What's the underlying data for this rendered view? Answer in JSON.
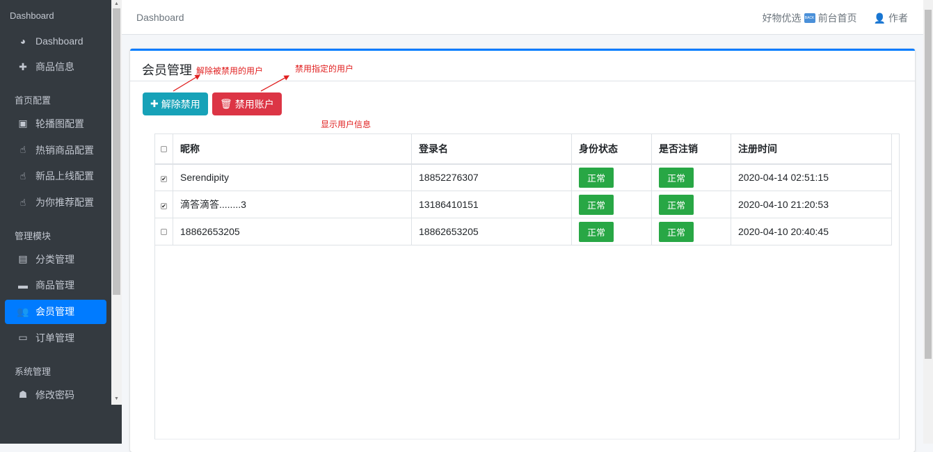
{
  "sidebar": {
    "sections": [
      {
        "title": "Dashboard",
        "items": [
          {
            "label": "Dashboard",
            "icon": "tachometer-icon"
          },
          {
            "label": "商品信息",
            "icon": "plus-icon"
          }
        ]
      },
      {
        "title": "首页配置",
        "items": [
          {
            "label": "轮播图配置",
            "icon": "image-icon"
          },
          {
            "label": "热销商品配置",
            "icon": "hand-pointer-icon"
          },
          {
            "label": "新品上线配置",
            "icon": "hand-pointer-icon"
          },
          {
            "label": "为你推荐配置",
            "icon": "hand-pointer-icon"
          }
        ]
      },
      {
        "title": "管理模块",
        "items": [
          {
            "label": "分类管理",
            "icon": "list-alt-icon"
          },
          {
            "label": "商品管理",
            "icon": "archive-icon"
          },
          {
            "label": "会员管理",
            "icon": "users-icon",
            "active": true
          },
          {
            "label": "订单管理",
            "icon": "money-bill-icon"
          }
        ]
      },
      {
        "title": "系统管理",
        "items": [
          {
            "label": "修改密码",
            "icon": "user-secret-icon"
          }
        ]
      }
    ],
    "active_color": "#007bff"
  },
  "topbar": {
    "breadcrumb": "Dashboard",
    "shop_link": "好物优选",
    "back_icon_text": "BACK",
    "home_link": "前台首页",
    "author_link": "作者"
  },
  "card": {
    "title": "会员管理",
    "buttons": {
      "unban": "解除禁用",
      "ban": "禁用账户"
    },
    "notes": {
      "unban": "解除被禁用的用户",
      "ban": "禁用指定的用户",
      "table": "显示用户信息"
    }
  },
  "table": {
    "columns": [
      "昵称",
      "登录名",
      "身份状态",
      "是否注销",
      "注册时间"
    ],
    "rows": [
      {
        "checked": true,
        "nickname": "Serendipity",
        "login": "18852276307",
        "status": "正常",
        "deleted": "正常",
        "time": "2020-04-14 02:51:15"
      },
      {
        "checked": true,
        "nickname": "滴答滴答........3",
        "login": "13186410151",
        "status": "正常",
        "deleted": "正常",
        "time": "2020-04-10 21:20:53"
      },
      {
        "checked": false,
        "nickname": "18862653205",
        "login": "18862653205",
        "status": "正常",
        "deleted": "正常",
        "time": "2020-04-10 20:40:45"
      }
    ]
  }
}
